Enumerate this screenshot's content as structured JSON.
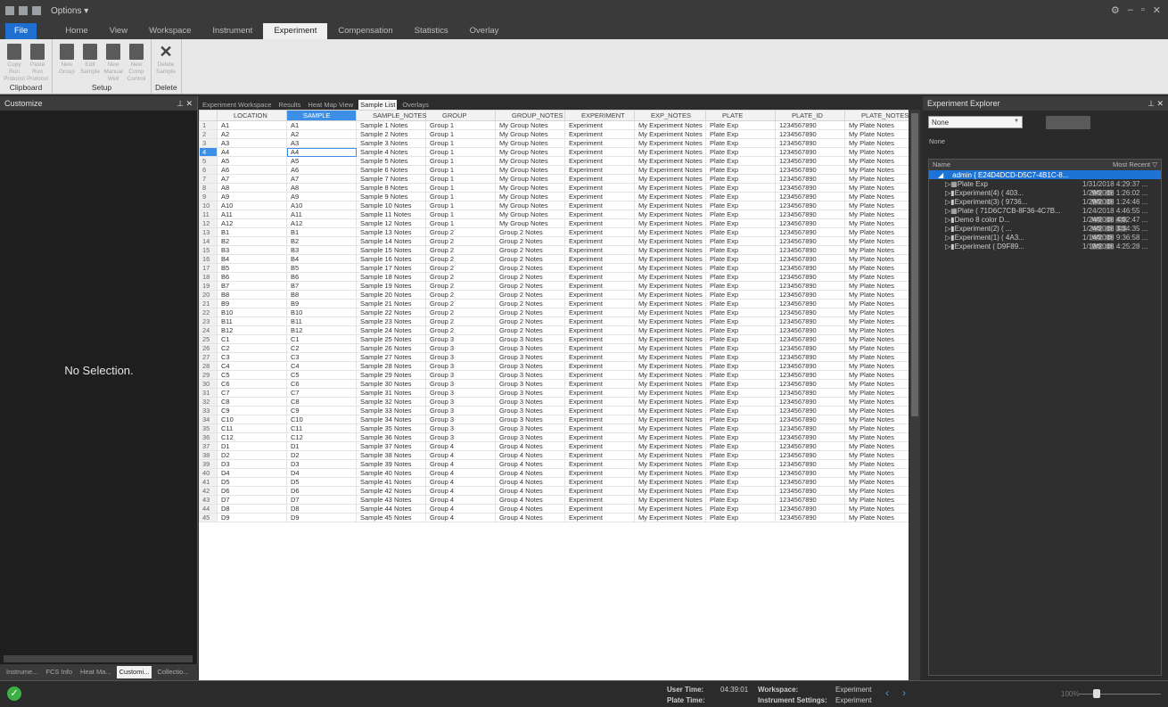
{
  "title_bar": {
    "options": "Options ▾"
  },
  "ribbon_tabs": [
    "Home",
    "View",
    "Workspace",
    "Instrument",
    "Experiment",
    "Compensation",
    "Statistics",
    "Overlay"
  ],
  "file_tab": "File",
  "active_ribbon_tab": "Experiment",
  "ribbon_groups": [
    {
      "label": "Clipboard",
      "buttons": [
        "Copy Run Protocol",
        "Paste Run Protocol"
      ]
    },
    {
      "label": "Setup",
      "buttons": [
        "New Group",
        "Edit Sample",
        "New Manual Well",
        "New Comp Control"
      ]
    },
    {
      "label": "Delete",
      "buttons": [
        "Delete Sample"
      ]
    }
  ],
  "left_panel": {
    "title": "Customize",
    "message": "No Selection.",
    "tabs": [
      "Instrume...",
      "FCS Info",
      "Heat Ma...",
      "Customi...",
      "Collectio..."
    ],
    "active_tab": "Customi..."
  },
  "doc_tabs": [
    "Experiment Workspace",
    "Results",
    "Heat Map View",
    "Sample List",
    "Overlays"
  ],
  "active_doc_tab": "Sample List",
  "table": {
    "columns": [
      "LOCATION",
      "SAMPLE",
      "SAMPLE_NOTES",
      "GROUP",
      "GROUP_NOTES",
      "EXPERIMENT",
      "EXP_NOTES",
      "PLATE",
      "PLATE_ID",
      "PLATE_NOTES"
    ],
    "rows": [
      [
        "1",
        "A1",
        "A1",
        "Sample 1 Notes",
        "Group 1",
        "My Group Notes",
        "Experiment",
        "My Experiment Notes",
        "Plate Exp",
        "1234567890",
        "My Plate Notes"
      ],
      [
        "2",
        "A2",
        "A2",
        "Sample 2 Notes",
        "Group 1",
        "My Group Notes",
        "Experiment",
        "My Experiment Notes",
        "Plate Exp",
        "1234567890",
        "My Plate Notes"
      ],
      [
        "3",
        "A3",
        "A3",
        "Sample 3 Notes",
        "Group 1",
        "My Group Notes",
        "Experiment",
        "My Experiment Notes",
        "Plate Exp",
        "1234567890",
        "My Plate Notes"
      ],
      [
        "4",
        "A4",
        "A4",
        "Sample 4 Notes",
        "Group 1",
        "My Group Notes",
        "Experiment",
        "My Experiment Notes",
        "Plate Exp",
        "1234567890",
        "My Plate Notes"
      ],
      [
        "5",
        "A5",
        "A5",
        "Sample 5 Notes",
        "Group 1",
        "My Group Notes",
        "Experiment",
        "My Experiment Notes",
        "Plate Exp",
        "1234567890",
        "My Plate Notes"
      ],
      [
        "6",
        "A6",
        "A6",
        "Sample 6 Notes",
        "Group 1",
        "My Group Notes",
        "Experiment",
        "My Experiment Notes",
        "Plate Exp",
        "1234567890",
        "My Plate Notes"
      ],
      [
        "7",
        "A7",
        "A7",
        "Sample 7 Notes",
        "Group 1",
        "My Group Notes",
        "Experiment",
        "My Experiment Notes",
        "Plate Exp",
        "1234567890",
        "My Plate Notes"
      ],
      [
        "8",
        "A8",
        "A8",
        "Sample 8 Notes",
        "Group 1",
        "My Group Notes",
        "Experiment",
        "My Experiment Notes",
        "Plate Exp",
        "1234567890",
        "My Plate Notes"
      ],
      [
        "9",
        "A9",
        "A9",
        "Sample 9 Notes",
        "Group 1",
        "My Group Notes",
        "Experiment",
        "My Experiment Notes",
        "Plate Exp",
        "1234567890",
        "My Plate Notes"
      ],
      [
        "10",
        "A10",
        "A10",
        "Sample 10 Notes",
        "Group 1",
        "My Group Notes",
        "Experiment",
        "My Experiment Notes",
        "Plate Exp",
        "1234567890",
        "My Plate Notes"
      ],
      [
        "11",
        "A11",
        "A11",
        "Sample 11 Notes",
        "Group 1",
        "My Group Notes",
        "Experiment",
        "My Experiment Notes",
        "Plate Exp",
        "1234567890",
        "My Plate Notes"
      ],
      [
        "12",
        "A12",
        "A12",
        "Sample 12 Notes",
        "Group 1",
        "My Group Notes",
        "Experiment",
        "My Experiment Notes",
        "Plate Exp",
        "1234567890",
        "My Plate Notes"
      ],
      [
        "13",
        "B1",
        "B1",
        "Sample 13 Notes",
        "Group 2",
        "Group 2 Notes",
        "Experiment",
        "My Experiment Notes",
        "Plate Exp",
        "1234567890",
        "My Plate Notes"
      ],
      [
        "14",
        "B2",
        "B2",
        "Sample 14 Notes",
        "Group 2",
        "Group 2 Notes",
        "Experiment",
        "My Experiment Notes",
        "Plate Exp",
        "1234567890",
        "My Plate Notes"
      ],
      [
        "15",
        "B3",
        "B3",
        "Sample 15 Notes",
        "Group 2",
        "Group 2 Notes",
        "Experiment",
        "My Experiment Notes",
        "Plate Exp",
        "1234567890",
        "My Plate Notes"
      ],
      [
        "16",
        "B4",
        "B4",
        "Sample 16 Notes",
        "Group 2",
        "Group 2 Notes",
        "Experiment",
        "My Experiment Notes",
        "Plate Exp",
        "1234567890",
        "My Plate Notes"
      ],
      [
        "17",
        "B5",
        "B5",
        "Sample 17 Notes",
        "Group 2",
        "Group 2 Notes",
        "Experiment",
        "My Experiment Notes",
        "Plate Exp",
        "1234567890",
        "My Plate Notes"
      ],
      [
        "18",
        "B6",
        "B6",
        "Sample 18 Notes",
        "Group 2",
        "Group 2 Notes",
        "Experiment",
        "My Experiment Notes",
        "Plate Exp",
        "1234567890",
        "My Plate Notes"
      ],
      [
        "19",
        "B7",
        "B7",
        "Sample 19 Notes",
        "Group 2",
        "Group 2 Notes",
        "Experiment",
        "My Experiment Notes",
        "Plate Exp",
        "1234567890",
        "My Plate Notes"
      ],
      [
        "20",
        "B8",
        "B8",
        "Sample 20 Notes",
        "Group 2",
        "Group 2 Notes",
        "Experiment",
        "My Experiment Notes",
        "Plate Exp",
        "1234567890",
        "My Plate Notes"
      ],
      [
        "21",
        "B9",
        "B9",
        "Sample 21 Notes",
        "Group 2",
        "Group 2 Notes",
        "Experiment",
        "My Experiment Notes",
        "Plate Exp",
        "1234567890",
        "My Plate Notes"
      ],
      [
        "22",
        "B10",
        "B10",
        "Sample 22 Notes",
        "Group 2",
        "Group 2 Notes",
        "Experiment",
        "My Experiment Notes",
        "Plate Exp",
        "1234567890",
        "My Plate Notes"
      ],
      [
        "23",
        "B11",
        "B11",
        "Sample 23 Notes",
        "Group 2",
        "Group 2 Notes",
        "Experiment",
        "My Experiment Notes",
        "Plate Exp",
        "1234567890",
        "My Plate Notes"
      ],
      [
        "24",
        "B12",
        "B12",
        "Sample 24 Notes",
        "Group 2",
        "Group 2 Notes",
        "Experiment",
        "My Experiment Notes",
        "Plate Exp",
        "1234567890",
        "My Plate Notes"
      ],
      [
        "25",
        "C1",
        "C1",
        "Sample 25 Notes",
        "Group 3",
        "Group 3 Notes",
        "Experiment",
        "My Experiment Notes",
        "Plate Exp",
        "1234567890",
        "My Plate Notes"
      ],
      [
        "26",
        "C2",
        "C2",
        "Sample 26 Notes",
        "Group 3",
        "Group 3 Notes",
        "Experiment",
        "My Experiment Notes",
        "Plate Exp",
        "1234567890",
        "My Plate Notes"
      ],
      [
        "27",
        "C3",
        "C3",
        "Sample 27 Notes",
        "Group 3",
        "Group 3 Notes",
        "Experiment",
        "My Experiment Notes",
        "Plate Exp",
        "1234567890",
        "My Plate Notes"
      ],
      [
        "28",
        "C4",
        "C4",
        "Sample 28 Notes",
        "Group 3",
        "Group 3 Notes",
        "Experiment",
        "My Experiment Notes",
        "Plate Exp",
        "1234567890",
        "My Plate Notes"
      ],
      [
        "29",
        "C5",
        "C5",
        "Sample 29 Notes",
        "Group 3",
        "Group 3 Notes",
        "Experiment",
        "My Experiment Notes",
        "Plate Exp",
        "1234567890",
        "My Plate Notes"
      ],
      [
        "30",
        "C6",
        "C6",
        "Sample 30 Notes",
        "Group 3",
        "Group 3 Notes",
        "Experiment",
        "My Experiment Notes",
        "Plate Exp",
        "1234567890",
        "My Plate Notes"
      ],
      [
        "31",
        "C7",
        "C7",
        "Sample 31 Notes",
        "Group 3",
        "Group 3 Notes",
        "Experiment",
        "My Experiment Notes",
        "Plate Exp",
        "1234567890",
        "My Plate Notes"
      ],
      [
        "32",
        "C8",
        "C8",
        "Sample 32 Notes",
        "Group 3",
        "Group 3 Notes",
        "Experiment",
        "My Experiment Notes",
        "Plate Exp",
        "1234567890",
        "My Plate Notes"
      ],
      [
        "33",
        "C9",
        "C9",
        "Sample 33 Notes",
        "Group 3",
        "Group 3 Notes",
        "Experiment",
        "My Experiment Notes",
        "Plate Exp",
        "1234567890",
        "My Plate Notes"
      ],
      [
        "34",
        "C10",
        "C10",
        "Sample 34 Notes",
        "Group 3",
        "Group 3 Notes",
        "Experiment",
        "My Experiment Notes",
        "Plate Exp",
        "1234567890",
        "My Plate Notes"
      ],
      [
        "35",
        "C11",
        "C11",
        "Sample 35 Notes",
        "Group 3",
        "Group 3 Notes",
        "Experiment",
        "My Experiment Notes",
        "Plate Exp",
        "1234567890",
        "My Plate Notes"
      ],
      [
        "36",
        "C12",
        "C12",
        "Sample 36 Notes",
        "Group 3",
        "Group 3 Notes",
        "Experiment",
        "My Experiment Notes",
        "Plate Exp",
        "1234567890",
        "My Plate Notes"
      ],
      [
        "37",
        "D1",
        "D1",
        "Sample 37 Notes",
        "Group 4",
        "Group 4 Notes",
        "Experiment",
        "My Experiment Notes",
        "Plate Exp",
        "1234567890",
        "My Plate Notes"
      ],
      [
        "38",
        "D2",
        "D2",
        "Sample 38 Notes",
        "Group 4",
        "Group 4 Notes",
        "Experiment",
        "My Experiment Notes",
        "Plate Exp",
        "1234567890",
        "My Plate Notes"
      ],
      [
        "39",
        "D3",
        "D3",
        "Sample 39 Notes",
        "Group 4",
        "Group 4 Notes",
        "Experiment",
        "My Experiment Notes",
        "Plate Exp",
        "1234567890",
        "My Plate Notes"
      ],
      [
        "40",
        "D4",
        "D4",
        "Sample 40 Notes",
        "Group 4",
        "Group 4 Notes",
        "Experiment",
        "My Experiment Notes",
        "Plate Exp",
        "1234567890",
        "My Plate Notes"
      ],
      [
        "41",
        "D5",
        "D5",
        "Sample 41 Notes",
        "Group 4",
        "Group 4 Notes",
        "Experiment",
        "My Experiment Notes",
        "Plate Exp",
        "1234567890",
        "My Plate Notes"
      ],
      [
        "42",
        "D6",
        "D6",
        "Sample 42 Notes",
        "Group 4",
        "Group 4 Notes",
        "Experiment",
        "My Experiment Notes",
        "Plate Exp",
        "1234567890",
        "My Plate Notes"
      ],
      [
        "43",
        "D7",
        "D7",
        "Sample 43 Notes",
        "Group 4",
        "Group 4 Notes",
        "Experiment",
        "My Experiment Notes",
        "Plate Exp",
        "1234567890",
        "My Plate Notes"
      ],
      [
        "44",
        "D8",
        "D8",
        "Sample 44 Notes",
        "Group 4",
        "Group 4 Notes",
        "Experiment",
        "My Experiment Notes",
        "Plate Exp",
        "1234567890",
        "My Plate Notes"
      ],
      [
        "45",
        "D9",
        "D9",
        "Sample 45 Notes",
        "Group 4",
        "Group 4 Notes",
        "Experiment",
        "My Experiment Notes",
        "Plate Exp",
        "1234567890",
        "My Plate Notes"
      ]
    ],
    "selected_row": 4
  },
  "explorer": {
    "title": "Experiment Explorer",
    "dropdown_value": "None",
    "none_label": "None",
    "tree_headers": {
      "name": "Name",
      "recent": "Most Recent"
    },
    "root": "admin { E24D4DCD-D5C7-4B1C-8...",
    "items": [
      {
        "name": "Plate Exp",
        "badges": [],
        "date": "1/31/2018 4:29:37 ..."
      },
      {
        "name": "Experiment(4) ( 403...",
        "badges": [
          "WS",
          "IS"
        ],
        "date": "1/29/2018 1:26:02 ..."
      },
      {
        "name": "Experiment(3) ( 9736...",
        "badges": [
          "WS",
          "IS"
        ],
        "date": "1/29/2018 1:24:46 ..."
      },
      {
        "name": "Plate ( 71D6C7CB-8F36-4C7B...",
        "badges": [],
        "date": "1/24/2018 4:46:55 ..."
      },
      {
        "name": "Demo 8 color D...",
        "badges": [
          "WS",
          "IS",
          "CS"
        ],
        "date": "1/24/2018 4:02:47 ..."
      },
      {
        "name": "Experiment(2) ( ...",
        "badges": [
          "WS",
          "IS",
          "CS"
        ],
        "date": "1/24/2018 3:34:35 ..."
      },
      {
        "name": "Experiment(1) ( 4A3...",
        "badges": [
          "WS",
          "IS"
        ],
        "date": "1/14/2018 9:36:58 ..."
      },
      {
        "name": "Experiment ( D9F89...",
        "badges": [
          "WS",
          "IS"
        ],
        "date": "1/12/2018 4:25:28 ..."
      }
    ]
  },
  "status": {
    "user_time_label": "User Time:",
    "user_time": "04:39:01",
    "plate_time_label": "Plate Time:",
    "workspace_label": "Workspace:",
    "workspace": "Experiment",
    "instrument_label": "Instrument Settings:",
    "instrument": "Experiment",
    "zoom": "100%"
  },
  "colors": {
    "accent": "#1f73d4",
    "ok": "#3cb043"
  }
}
